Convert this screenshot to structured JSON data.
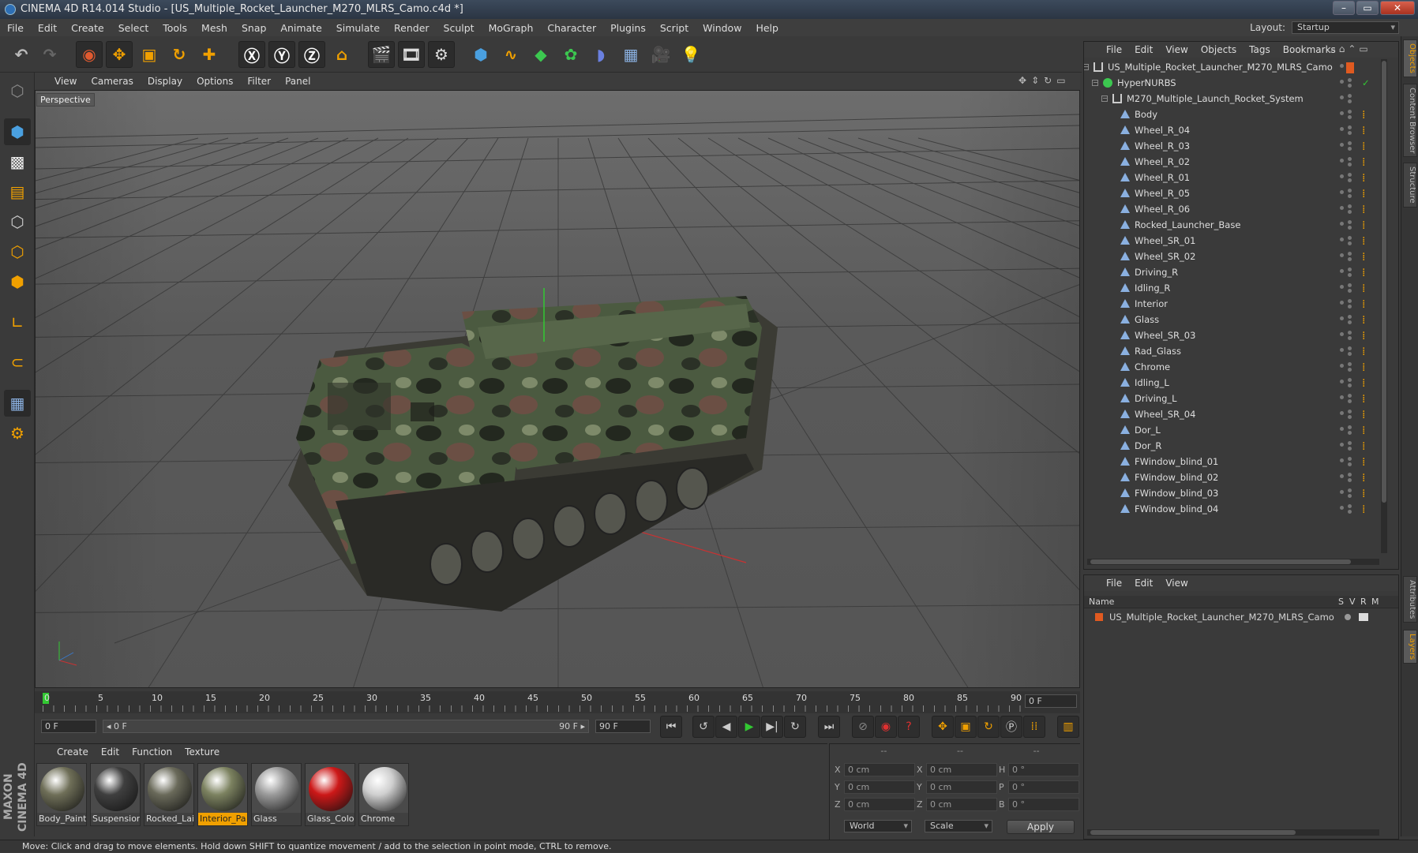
{
  "window": {
    "title": "CINEMA 4D R14.014 Studio - [US_Multiple_Rocket_Launcher_M270_MLRS_Camo.c4d *]",
    "minimize": "–",
    "maximize": "▭",
    "close": "✕"
  },
  "menu": [
    "File",
    "Edit",
    "Create",
    "Select",
    "Tools",
    "Mesh",
    "Snap",
    "Animate",
    "Simulate",
    "Render",
    "Sculpt",
    "MoGraph",
    "Character",
    "Plugins",
    "Script",
    "Window",
    "Help"
  ],
  "layout": {
    "label": "Layout:",
    "value": "Startup"
  },
  "viewport": {
    "menu": [
      "View",
      "Cameras",
      "Display",
      "Options",
      "Filter",
      "Panel"
    ],
    "label": "Perspective"
  },
  "timeline": {
    "ticks": [
      "0",
      "5",
      "10",
      "15",
      "20",
      "25",
      "30",
      "35",
      "40",
      "45",
      "50",
      "55",
      "60",
      "65",
      "70",
      "75",
      "80",
      "85",
      "90"
    ],
    "current_frame": "0 F",
    "start_frame": "0 F",
    "range_start": "◂ 0 F",
    "range_end": "90 F ▸",
    "end_frame": "90 F"
  },
  "materials": {
    "menu": [
      "Create",
      "Edit",
      "Function",
      "Texture"
    ],
    "items": [
      {
        "label": "Body_Paint",
        "color": "#6f6f58"
      },
      {
        "label": "Suspensior",
        "color": "#3f3f3f"
      },
      {
        "label": "Rocked_Lai",
        "color": "#6a6a5a"
      },
      {
        "label": "Interior_Pa",
        "color": "#7c8260"
      },
      {
        "label": "Glass",
        "color": "#9a9a9a"
      },
      {
        "label": "Glass_Colo",
        "color": "#cc1818"
      },
      {
        "label": "Chrome",
        "color": "#cfcfcf"
      }
    ]
  },
  "coords": {
    "header": [
      "--",
      "--",
      "--"
    ],
    "rows": [
      {
        "a": "X",
        "av": "0 cm",
        "b": "X",
        "bv": "0 cm",
        "c": "H",
        "cv": "0 °"
      },
      {
        "a": "Y",
        "av": "0 cm",
        "b": "Y",
        "bv": "0 cm",
        "c": "P",
        "cv": "0 °"
      },
      {
        "a": "Z",
        "av": "0 cm",
        "b": "Z",
        "bv": "0 cm",
        "c": "B",
        "cv": "0 °"
      }
    ],
    "mode": "World",
    "scale": "Scale",
    "apply": "Apply"
  },
  "objects": {
    "menu": [
      "File",
      "Edit",
      "View",
      "Objects",
      "Tags",
      "Bookmarks"
    ],
    "root": "US_Multiple_Rocket_Launcher_M270_MLRS_Camo",
    "nurbs": "HyperNURBS",
    "group": "M270_Multiple_Launch_Rocket_System",
    "children": [
      "Body",
      "Wheel_R_04",
      "Wheel_R_03",
      "Wheel_R_02",
      "Wheel_R_01",
      "Wheel_R_05",
      "Wheel_R_06",
      "Rocked_Launcher_Base",
      "Wheel_SR_01",
      "Wheel_SR_02",
      "Driving_R",
      "Idling_R",
      "Interior",
      "Glass",
      "Wheel_SR_03",
      "Rad_Glass",
      "Chrome",
      "Idling_L",
      "Driving_L",
      "Wheel_SR_04",
      "Dor_L",
      "Dor_R",
      "FWindow_blind_01",
      "FWindow_blind_02",
      "FWindow_blind_03",
      "FWindow_blind_04"
    ]
  },
  "side_tabs": [
    "Objects",
    "Content Browser",
    "Structure"
  ],
  "side_tabs_lower": [
    "Attributes",
    "Layers"
  ],
  "layers": {
    "menu": [
      "File",
      "Edit",
      "View"
    ],
    "columns": [
      "Name",
      "S",
      "V",
      "R",
      "M"
    ],
    "row": "US_Multiple_Rocket_Launcher_M270_MLRS_Camo"
  },
  "brand": "MAXON CINEMA 4D",
  "status": "Move: Click and drag to move elements. Hold down SHIFT to quantize movement / add to the selection in point mode, CTRL to remove.",
  "colors": {
    "accent": "#f0a000",
    "select_blue": "#3a78c8",
    "axis_x": "#c83232",
    "axis_y": "#32c832"
  }
}
